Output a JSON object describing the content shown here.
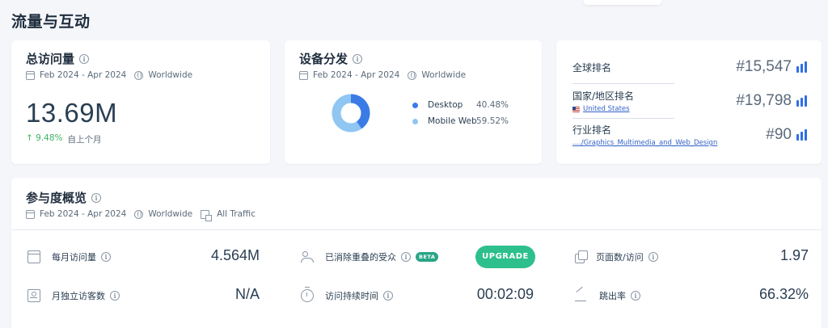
{
  "section_title": "流量与互动",
  "visits_card": {
    "title": "总访问量",
    "date_range": "Feb 2024 - Apr 2024",
    "region": "Worldwide",
    "value": "13.69M",
    "change": "↑ 9.48%",
    "change_label": "自上个月"
  },
  "device_card": {
    "title": "设备分发",
    "date_range": "Feb 2024 - Apr 2024",
    "region": "Worldwide",
    "chart_data": {
      "type": "pie",
      "categories": [
        "Desktop",
        "Mobile Web"
      ],
      "values": [
        40.48,
        59.52
      ],
      "colors": [
        "#3a7be6",
        "#8fc6f2"
      ]
    },
    "legend": [
      {
        "label": "Desktop",
        "value": "40.48%"
      },
      {
        "label": "Mobile Web",
        "value": "59.52%"
      }
    ]
  },
  "rank_card": {
    "global": {
      "label": "全球排名",
      "value": "#15,547"
    },
    "country": {
      "label": "国家/地区排名",
      "sub": "United States",
      "value": "#19,798"
    },
    "industry": {
      "label": "行业排名",
      "sub": "..../Graphics_Multimedia_and_Web_Design",
      "value": "#90"
    }
  },
  "engagement_card": {
    "title": "参与度概览",
    "date_range": "Feb 2024 - Apr 2024",
    "region": "Worldwide",
    "traffic": "All Traffic",
    "metrics": {
      "monthly_visits": {
        "label": "每月访问量",
        "value": "4.564M"
      },
      "unique_visitors": {
        "label": "月独立访客数",
        "value": "N/A"
      },
      "dedup_audience": {
        "label": "已消除重叠的受众",
        "badge": "BETA",
        "button": "UPGRADE"
      },
      "visit_duration": {
        "label": "访问持续时间",
        "value": "00:02:09"
      },
      "pages_per_visit": {
        "label": "页面数/访问",
        "value": "1.97"
      },
      "bounce_rate": {
        "label": "跳出率",
        "value": "66.32%"
      }
    }
  },
  "icons": {
    "info": "info-icon",
    "calendar": "calendar-icon",
    "globe": "globe-icon",
    "bars": "rank-bars-icon"
  },
  "colors": {
    "accent": "#2f6fe4",
    "positive": "#3fb464",
    "upgrade": "#2dbf8c",
    "beta": "#2aa587"
  }
}
